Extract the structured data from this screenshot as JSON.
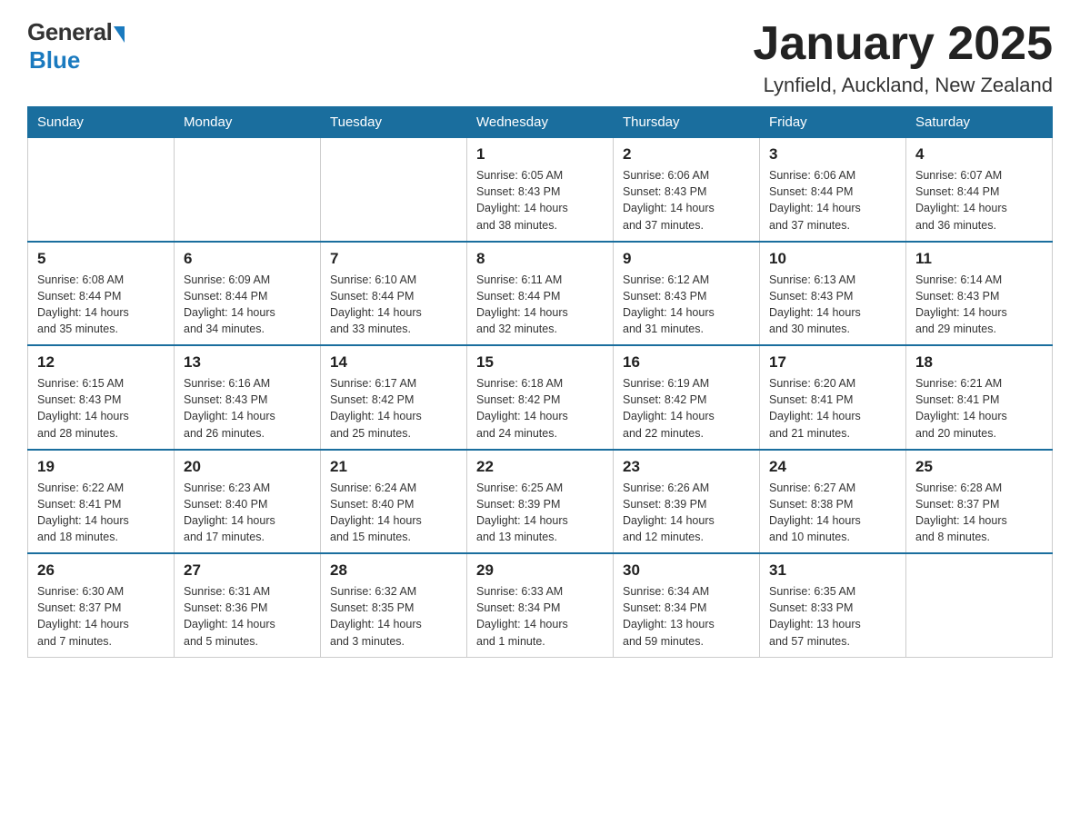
{
  "header": {
    "logo_general": "General",
    "logo_blue": "Blue",
    "title": "January 2025",
    "location": "Lynfield, Auckland, New Zealand"
  },
  "days_of_week": [
    "Sunday",
    "Monday",
    "Tuesday",
    "Wednesday",
    "Thursday",
    "Friday",
    "Saturday"
  ],
  "weeks": [
    [
      {
        "day": "",
        "info": ""
      },
      {
        "day": "",
        "info": ""
      },
      {
        "day": "",
        "info": ""
      },
      {
        "day": "1",
        "info": "Sunrise: 6:05 AM\nSunset: 8:43 PM\nDaylight: 14 hours\nand 38 minutes."
      },
      {
        "day": "2",
        "info": "Sunrise: 6:06 AM\nSunset: 8:43 PM\nDaylight: 14 hours\nand 37 minutes."
      },
      {
        "day": "3",
        "info": "Sunrise: 6:06 AM\nSunset: 8:44 PM\nDaylight: 14 hours\nand 37 minutes."
      },
      {
        "day": "4",
        "info": "Sunrise: 6:07 AM\nSunset: 8:44 PM\nDaylight: 14 hours\nand 36 minutes."
      }
    ],
    [
      {
        "day": "5",
        "info": "Sunrise: 6:08 AM\nSunset: 8:44 PM\nDaylight: 14 hours\nand 35 minutes."
      },
      {
        "day": "6",
        "info": "Sunrise: 6:09 AM\nSunset: 8:44 PM\nDaylight: 14 hours\nand 34 minutes."
      },
      {
        "day": "7",
        "info": "Sunrise: 6:10 AM\nSunset: 8:44 PM\nDaylight: 14 hours\nand 33 minutes."
      },
      {
        "day": "8",
        "info": "Sunrise: 6:11 AM\nSunset: 8:44 PM\nDaylight: 14 hours\nand 32 minutes."
      },
      {
        "day": "9",
        "info": "Sunrise: 6:12 AM\nSunset: 8:43 PM\nDaylight: 14 hours\nand 31 minutes."
      },
      {
        "day": "10",
        "info": "Sunrise: 6:13 AM\nSunset: 8:43 PM\nDaylight: 14 hours\nand 30 minutes."
      },
      {
        "day": "11",
        "info": "Sunrise: 6:14 AM\nSunset: 8:43 PM\nDaylight: 14 hours\nand 29 minutes."
      }
    ],
    [
      {
        "day": "12",
        "info": "Sunrise: 6:15 AM\nSunset: 8:43 PM\nDaylight: 14 hours\nand 28 minutes."
      },
      {
        "day": "13",
        "info": "Sunrise: 6:16 AM\nSunset: 8:43 PM\nDaylight: 14 hours\nand 26 minutes."
      },
      {
        "day": "14",
        "info": "Sunrise: 6:17 AM\nSunset: 8:42 PM\nDaylight: 14 hours\nand 25 minutes."
      },
      {
        "day": "15",
        "info": "Sunrise: 6:18 AM\nSunset: 8:42 PM\nDaylight: 14 hours\nand 24 minutes."
      },
      {
        "day": "16",
        "info": "Sunrise: 6:19 AM\nSunset: 8:42 PM\nDaylight: 14 hours\nand 22 minutes."
      },
      {
        "day": "17",
        "info": "Sunrise: 6:20 AM\nSunset: 8:41 PM\nDaylight: 14 hours\nand 21 minutes."
      },
      {
        "day": "18",
        "info": "Sunrise: 6:21 AM\nSunset: 8:41 PM\nDaylight: 14 hours\nand 20 minutes."
      }
    ],
    [
      {
        "day": "19",
        "info": "Sunrise: 6:22 AM\nSunset: 8:41 PM\nDaylight: 14 hours\nand 18 minutes."
      },
      {
        "day": "20",
        "info": "Sunrise: 6:23 AM\nSunset: 8:40 PM\nDaylight: 14 hours\nand 17 minutes."
      },
      {
        "day": "21",
        "info": "Sunrise: 6:24 AM\nSunset: 8:40 PM\nDaylight: 14 hours\nand 15 minutes."
      },
      {
        "day": "22",
        "info": "Sunrise: 6:25 AM\nSunset: 8:39 PM\nDaylight: 14 hours\nand 13 minutes."
      },
      {
        "day": "23",
        "info": "Sunrise: 6:26 AM\nSunset: 8:39 PM\nDaylight: 14 hours\nand 12 minutes."
      },
      {
        "day": "24",
        "info": "Sunrise: 6:27 AM\nSunset: 8:38 PM\nDaylight: 14 hours\nand 10 minutes."
      },
      {
        "day": "25",
        "info": "Sunrise: 6:28 AM\nSunset: 8:37 PM\nDaylight: 14 hours\nand 8 minutes."
      }
    ],
    [
      {
        "day": "26",
        "info": "Sunrise: 6:30 AM\nSunset: 8:37 PM\nDaylight: 14 hours\nand 7 minutes."
      },
      {
        "day": "27",
        "info": "Sunrise: 6:31 AM\nSunset: 8:36 PM\nDaylight: 14 hours\nand 5 minutes."
      },
      {
        "day": "28",
        "info": "Sunrise: 6:32 AM\nSunset: 8:35 PM\nDaylight: 14 hours\nand 3 minutes."
      },
      {
        "day": "29",
        "info": "Sunrise: 6:33 AM\nSunset: 8:34 PM\nDaylight: 14 hours\nand 1 minute."
      },
      {
        "day": "30",
        "info": "Sunrise: 6:34 AM\nSunset: 8:34 PM\nDaylight: 13 hours\nand 59 minutes."
      },
      {
        "day": "31",
        "info": "Sunrise: 6:35 AM\nSunset: 8:33 PM\nDaylight: 13 hours\nand 57 minutes."
      },
      {
        "day": "",
        "info": ""
      }
    ]
  ]
}
